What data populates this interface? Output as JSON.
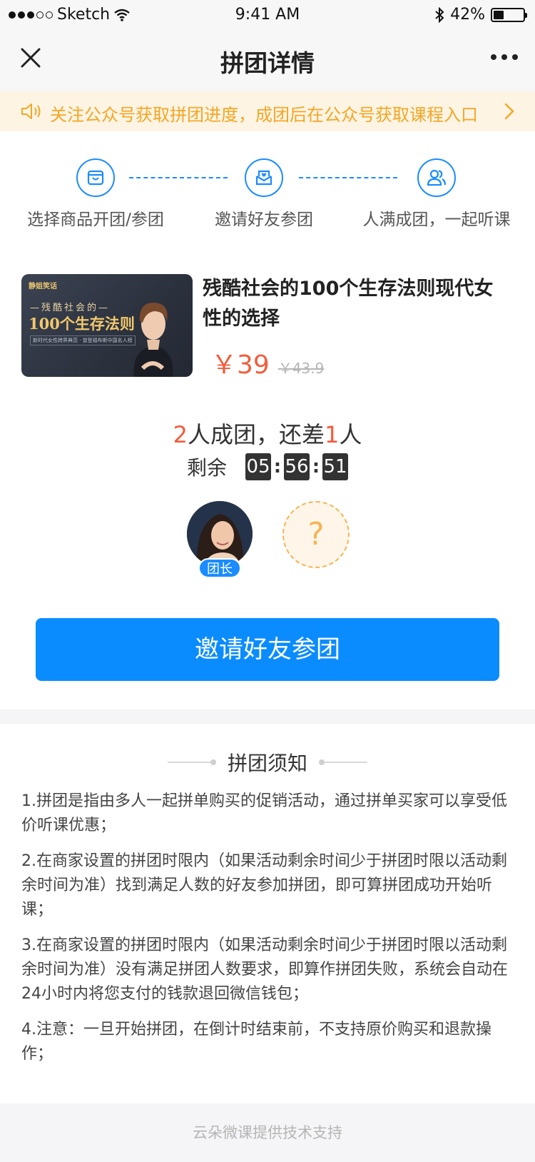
{
  "status_bar": {
    "carrier": "Sketch",
    "time": "9:41 AM",
    "battery_percent": "42%",
    "battery_level": 0.42
  },
  "nav": {
    "title": "拼团详情"
  },
  "notice": {
    "text": "关注公众号获取拼团进度，成团后在公众号获取课程入口"
  },
  "steps": [
    {
      "label": "选择商品开团/参团",
      "icon": "shopping-bag-icon"
    },
    {
      "label": "邀请好友参团",
      "icon": "envelope-heart-icon"
    },
    {
      "label": "人满成团，一起听课",
      "icon": "users-icon"
    }
  ],
  "product": {
    "cover": {
      "brand": "静姐笑话",
      "line1": "—残酷社会的—",
      "line2": "100个生存法则",
      "line3": "新时代女性跨界典范 · 曾登福布斯中国名人榜"
    },
    "title": "残酷社会的100个生存法则现代女性的选择",
    "price_now": "￥39",
    "price_old": "￥43.9"
  },
  "group": {
    "required": "2",
    "text_mid": "人成团，还差",
    "missing": "1",
    "text_end": "人"
  },
  "countdown": {
    "label": "剩余",
    "hours": "05",
    "minutes": "56",
    "seconds": "51"
  },
  "members": {
    "leader_badge": "团长",
    "empty_slot": "?"
  },
  "invite_button": "邀请好友参团",
  "rules": {
    "title": "拼团须知",
    "items": [
      "1.拼团是指由多人一起拼单购买的促销活动，通过拼单买家可以享受低价听课优惠；",
      "2.在商家设置的拼团时限内（如果活动剩余时间少于拼团时限以活动剩余时间为准）找到满足人数的好友参加拼团，即可算拼团成功开始听课；",
      "3.在商家设置的拼团时限内（如果活动剩余时间少于拼团时限以活动剩余时间为准）没有满足拼团人数要求，即算作拼团失败，系统会自动在24小时内将您支付的钱款退回微信钱包；",
      "4.注意：一旦开始拼团，在倒计时结束前，不支持原价购买和退款操作；"
    ]
  },
  "footer": "云朵微课提供技术支持",
  "colors": {
    "accent": "#0a8cff",
    "price": "#f25d3c",
    "notice_bg": "#fdf4e4",
    "notice_text": "#f5a623"
  }
}
